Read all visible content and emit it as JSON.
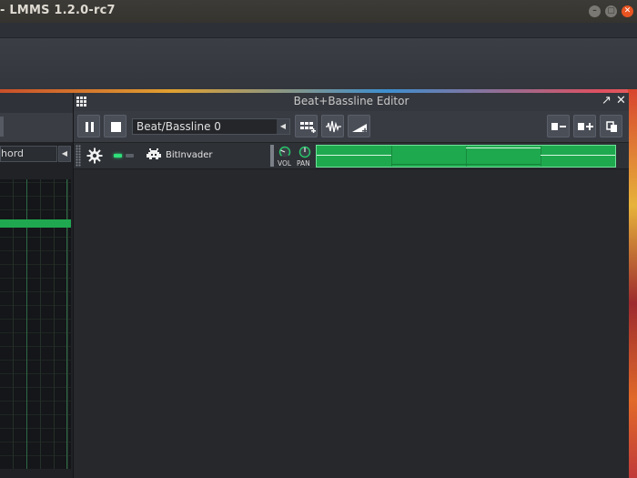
{
  "window": {
    "title": "- LMMS 1.2.0-rc7",
    "controls": {
      "minimize": "–",
      "maximize": "▢",
      "close": "✕"
    }
  },
  "piano_roll": {
    "chord_select": "hord",
    "chord_arrow": "◀"
  },
  "bb_editor": {
    "title": "Beat+Bassline Editor",
    "controls": {
      "restore": "↗",
      "close": "✕"
    },
    "toolbar": {
      "play_icon": "pause-icon",
      "stop_icon": "stop-icon",
      "bb_select": "Beat/Bassline 0",
      "bb_select_arrow": "◀",
      "add_steps_icon": "add-steps-icon",
      "add_sample_track_icon": "add-sample-track-icon",
      "add_automation_icon": "add-automation-icon",
      "remove_steps_icon": "remove-steps-icon",
      "add_steps_right_icon": "add-steps-right-icon",
      "clone_pattern_icon": "clone-pattern-icon"
    },
    "tracks": [
      {
        "name": "BitInvader",
        "settings_icon": "gear-icon",
        "mute_led": "on",
        "solo_led": "off",
        "vol_label": "VOL",
        "pan_label": "PAN"
      }
    ]
  },
  "colors": {
    "accent_green": "#1fa94e",
    "close_orange": "#e95420",
    "knob_green": "#27c46a"
  }
}
